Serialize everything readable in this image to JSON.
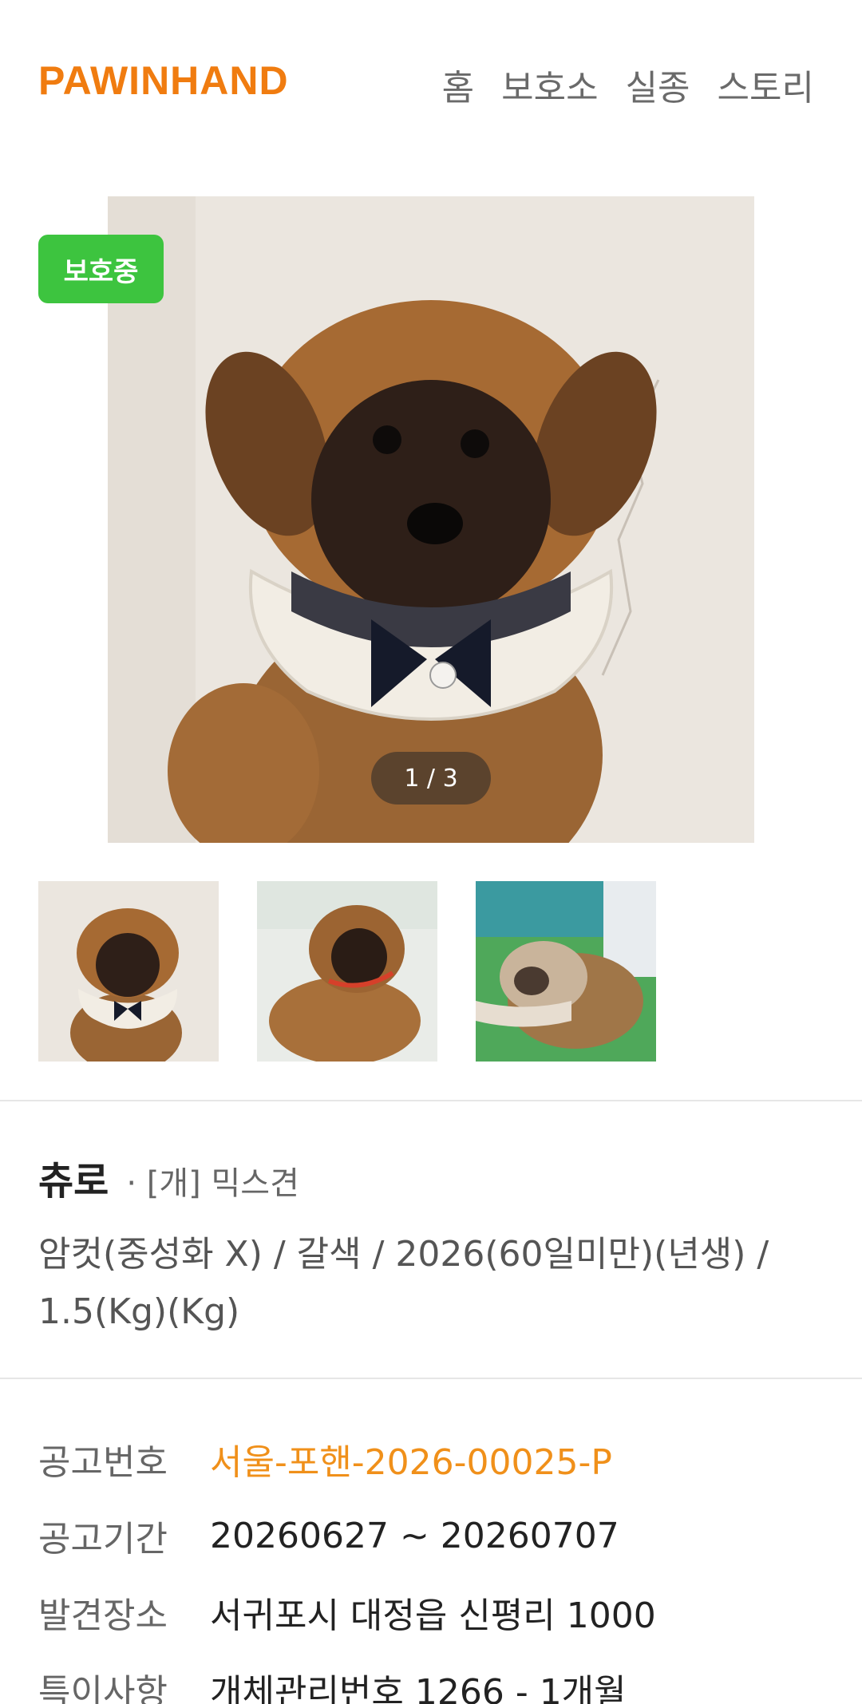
{
  "header": {
    "logo": "PAWINHAND",
    "nav": [
      "홈",
      "보호소",
      "실종",
      "스토리"
    ]
  },
  "gallery": {
    "status_badge": "보호중",
    "counter": "1 / 3"
  },
  "pet": {
    "name": "츄로",
    "breed": "· [개] 믹스견",
    "description": "암컷(중성화 X) / 갈색 / 2026(60일미만)(년생) / 1.5(Kg)(Kg)"
  },
  "details": [
    {
      "label": "공고번호",
      "value": "서울-포핸-2026-00025-P"
    },
    {
      "label": "공고기간",
      "value": "20260627 ~ 20260707"
    },
    {
      "label": "발견장소",
      "value": "서귀포시 대정읍 신평리 1000"
    },
    {
      "label": "특이사항",
      "value": "개체관리번호 1266 - 1개월"
    }
  ],
  "colors": {
    "brand": "#f07c10",
    "status_green": "#3dc43f",
    "accent_value": "#f0901a"
  }
}
